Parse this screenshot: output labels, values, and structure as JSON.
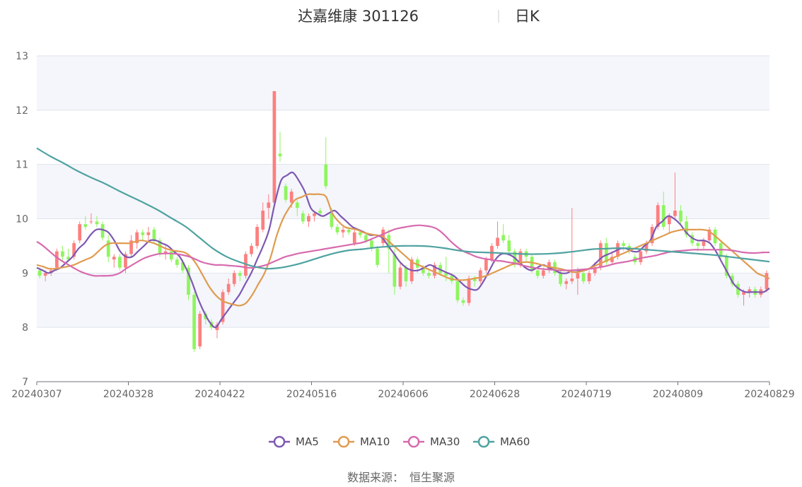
{
  "header": {
    "title": "达嘉维康 301126",
    "period": "日K"
  },
  "source": {
    "label": "数据来源：",
    "value": "恒生聚源"
  },
  "colors": {
    "up": "#fd7f7f",
    "down": "#8ef55e",
    "MA5": "#7e57b2",
    "MA10": "#e09b4f",
    "MA30": "#d76aae",
    "MA60": "#4fa2a0",
    "band": "#f4f6fb",
    "grid": "#dfe3ec"
  },
  "chart_data": {
    "type": "candlestick",
    "ylim": [
      7,
      13
    ],
    "yticks": [
      7,
      8,
      9,
      10,
      11,
      12,
      13
    ],
    "x_range": [
      "20240307",
      "20240829"
    ],
    "xticks": [
      "20240307",
      "20240328",
      "20240422",
      "20240516",
      "20240606",
      "20240628",
      "20240719",
      "20240809",
      "20240829"
    ],
    "legend": [
      "MA5",
      "MA10",
      "MA30",
      "MA60"
    ],
    "legend_position": "bottom-center",
    "candles_ohlc": [
      [
        9.05,
        9.1,
        8.9,
        8.95
      ],
      [
        8.95,
        9.05,
        8.85,
        9.0
      ],
      [
        9.0,
        9.1,
        8.95,
        9.05
      ],
      [
        9.1,
        9.45,
        9.05,
        9.4
      ],
      [
        9.4,
        9.5,
        9.2,
        9.3
      ],
      [
        9.3,
        9.45,
        9.2,
        9.25
      ],
      [
        9.3,
        9.6,
        9.25,
        9.55
      ],
      [
        9.6,
        9.95,
        9.55,
        9.9
      ],
      [
        9.9,
        10.05,
        9.8,
        9.85
      ],
      [
        9.95,
        10.1,
        9.9,
        9.95
      ],
      [
        9.95,
        10.05,
        9.85,
        9.9
      ],
      [
        9.9,
        9.95,
        9.6,
        9.65
      ],
      [
        9.6,
        9.7,
        9.2,
        9.3
      ],
      [
        9.25,
        9.35,
        9.1,
        9.3
      ],
      [
        9.3,
        9.35,
        9.05,
        9.1
      ],
      [
        9.1,
        9.4,
        9.0,
        9.35
      ],
      [
        9.35,
        9.7,
        9.3,
        9.6
      ],
      [
        9.55,
        9.8,
        9.45,
        9.75
      ],
      [
        9.75,
        9.8,
        9.6,
        9.7
      ],
      [
        9.7,
        9.85,
        9.6,
        9.75
      ],
      [
        9.8,
        9.85,
        9.55,
        9.6
      ],
      [
        9.6,
        9.65,
        9.3,
        9.35
      ],
      [
        9.35,
        9.5,
        9.25,
        9.4
      ],
      [
        9.4,
        9.45,
        9.2,
        9.25
      ],
      [
        9.25,
        9.3,
        9.1,
        9.15
      ],
      [
        9.2,
        9.25,
        9.0,
        9.05
      ],
      [
        9.1,
        9.15,
        8.5,
        8.6
      ],
      [
        8.6,
        8.65,
        7.55,
        7.6
      ],
      [
        7.65,
        8.3,
        7.6,
        8.25
      ],
      [
        8.25,
        8.3,
        8.05,
        8.15
      ],
      [
        8.1,
        8.15,
        7.95,
        8.0
      ],
      [
        7.95,
        8.1,
        7.8,
        8.05
      ],
      [
        8.1,
        8.7,
        8.05,
        8.65
      ],
      [
        8.65,
        8.9,
        8.6,
        8.8
      ],
      [
        8.8,
        9.05,
        8.75,
        9.0
      ],
      [
        9.0,
        9.05,
        8.85,
        8.95
      ],
      [
        8.95,
        9.4,
        8.9,
        9.35
      ],
      [
        9.35,
        9.55,
        9.3,
        9.5
      ],
      [
        9.5,
        9.9,
        9.45,
        9.85
      ],
      [
        9.8,
        10.3,
        9.75,
        10.15
      ],
      [
        10.2,
        10.45,
        10.0,
        10.3
      ],
      [
        10.3,
        12.35,
        10.25,
        12.35
      ],
      [
        11.2,
        11.6,
        11.05,
        11.15
      ],
      [
        10.6,
        10.65,
        10.3,
        10.35
      ],
      [
        10.3,
        10.55,
        10.2,
        10.5
      ],
      [
        10.3,
        10.35,
        10.05,
        10.2
      ],
      [
        10.1,
        10.15,
        9.9,
        9.95
      ],
      [
        9.95,
        10.1,
        9.85,
        10.05
      ],
      [
        10.05,
        10.15,
        9.95,
        10.1
      ],
      [
        10.15,
        10.2,
        10.05,
        10.1
      ],
      [
        11.0,
        11.5,
        10.55,
        10.6
      ],
      [
        10.1,
        10.2,
        9.8,
        9.85
      ],
      [
        9.85,
        9.9,
        9.7,
        9.75
      ],
      [
        9.75,
        9.85,
        9.65,
        9.8
      ],
      [
        9.8,
        9.85,
        9.7,
        9.75
      ],
      [
        9.55,
        9.8,
        9.5,
        9.75
      ],
      [
        9.75,
        9.8,
        9.65,
        9.7
      ],
      [
        9.7,
        9.75,
        9.55,
        9.6
      ],
      [
        9.6,
        9.65,
        9.4,
        9.45
      ],
      [
        9.45,
        9.5,
        9.1,
        9.15
      ],
      [
        9.55,
        9.85,
        9.5,
        9.8
      ],
      [
        9.7,
        9.8,
        9.0,
        9.45
      ],
      [
        9.35,
        9.45,
        8.6,
        8.75
      ],
      [
        8.75,
        9.2,
        8.7,
        9.1
      ],
      [
        9.1,
        9.15,
        8.75,
        8.85
      ],
      [
        8.85,
        9.3,
        8.8,
        9.25
      ],
      [
        9.25,
        9.3,
        9.0,
        9.1
      ],
      [
        9.1,
        9.15,
        8.95,
        9.0
      ],
      [
        9.0,
        9.05,
        8.9,
        8.95
      ],
      [
        8.95,
        9.2,
        8.9,
        9.15
      ],
      [
        9.15,
        9.2,
        8.95,
        9.0
      ],
      [
        9.0,
        9.3,
        8.85,
        8.95
      ],
      [
        8.95,
        9.0,
        8.8,
        8.85
      ],
      [
        8.85,
        8.9,
        8.45,
        8.5
      ],
      [
        8.5,
        8.55,
        8.4,
        8.45
      ],
      [
        8.45,
        8.95,
        8.4,
        8.9
      ],
      [
        8.9,
        8.95,
        8.75,
        8.85
      ],
      [
        8.85,
        9.1,
        8.8,
        9.05
      ],
      [
        9.05,
        9.3,
        9.0,
        9.25
      ],
      [
        9.25,
        9.55,
        9.2,
        9.5
      ],
      [
        9.5,
        9.95,
        9.45,
        9.65
      ],
      [
        9.7,
        9.9,
        9.55,
        9.6
      ],
      [
        9.6,
        9.7,
        9.35,
        9.4
      ],
      [
        9.4,
        9.45,
        9.1,
        9.15
      ],
      [
        9.15,
        9.45,
        9.1,
        9.4
      ],
      [
        9.4,
        9.45,
        9.2,
        9.3
      ],
      [
        9.3,
        9.35,
        9.0,
        9.05
      ],
      [
        9.05,
        9.1,
        8.9,
        8.95
      ],
      [
        8.95,
        9.1,
        8.9,
        9.05
      ],
      [
        9.05,
        9.25,
        9.0,
        9.2
      ],
      [
        9.2,
        9.25,
        8.95,
        9.0
      ],
      [
        9.0,
        9.05,
        8.75,
        8.8
      ],
      [
        8.8,
        8.9,
        8.7,
        8.85
      ],
      [
        8.85,
        10.2,
        8.8,
        8.9
      ],
      [
        8.9,
        9.1,
        8.6,
        9.0
      ],
      [
        9.0,
        9.05,
        8.8,
        8.85
      ],
      [
        8.85,
        9.05,
        8.8,
        9.0
      ],
      [
        9.0,
        9.2,
        8.95,
        9.1
      ],
      [
        9.1,
        9.6,
        9.05,
        9.55
      ],
      [
        9.55,
        9.65,
        9.15,
        9.2
      ],
      [
        9.2,
        9.4,
        9.15,
        9.3
      ],
      [
        9.3,
        9.6,
        9.25,
        9.55
      ],
      [
        9.55,
        9.6,
        9.4,
        9.5
      ],
      [
        9.5,
        9.55,
        9.35,
        9.4
      ],
      [
        9.3,
        9.35,
        9.15,
        9.2
      ],
      [
        9.2,
        9.45,
        9.15,
        9.4
      ],
      [
        9.4,
        9.6,
        9.35,
        9.55
      ],
      [
        9.55,
        9.9,
        9.5,
        9.85
      ],
      [
        9.85,
        10.3,
        9.8,
        10.25
      ],
      [
        10.25,
        10.5,
        9.8,
        9.85
      ],
      [
        9.9,
        10.1,
        9.75,
        10.05
      ],
      [
        10.05,
        10.85,
        10.0,
        10.15
      ],
      [
        10.15,
        10.25,
        9.9,
        9.95
      ],
      [
        9.95,
        10.05,
        9.65,
        9.7
      ],
      [
        9.7,
        9.75,
        9.5,
        9.55
      ],
      [
        9.55,
        9.6,
        9.4,
        9.5
      ],
      [
        9.5,
        9.65,
        9.45,
        9.6
      ],
      [
        9.6,
        9.85,
        9.55,
        9.8
      ],
      [
        9.8,
        9.85,
        9.5,
        9.55
      ],
      [
        9.55,
        9.6,
        9.25,
        9.3
      ],
      [
        9.3,
        9.35,
        8.9,
        8.95
      ],
      [
        8.95,
        9.0,
        8.75,
        8.8
      ],
      [
        8.8,
        8.85,
        8.55,
        8.6
      ],
      [
        8.6,
        8.7,
        8.4,
        8.65
      ],
      [
        8.65,
        8.75,
        8.55,
        8.7
      ],
      [
        8.7,
        8.75,
        8.55,
        8.6
      ],
      [
        8.6,
        8.75,
        8.55,
        8.7
      ],
      [
        8.7,
        9.05,
        8.65,
        9.0
      ]
    ],
    "series": [
      {
        "name": "MA5",
        "values": [
          9.1,
          9.05,
          9.0,
          9.05,
          9.1,
          9.2,
          9.3,
          9.45,
          9.55,
          9.7,
          9.8,
          9.8,
          9.75,
          9.6,
          9.4,
          9.3,
          9.3,
          9.4,
          9.5,
          9.6,
          9.6,
          9.55,
          9.5,
          9.4,
          9.3,
          9.1,
          8.85,
          8.55,
          8.3,
          8.1,
          8.0,
          8.15,
          8.3,
          8.45,
          8.6,
          8.8,
          9.0,
          9.25,
          9.5,
          9.8,
          10.3,
          10.7,
          10.8,
          10.85,
          10.7,
          10.5,
          10.2,
          10.1,
          10.05,
          10.1,
          10.15,
          10.05,
          9.95,
          9.85,
          9.8,
          9.75,
          9.7,
          9.7,
          9.65,
          9.5,
          9.35,
          9.2,
          9.1,
          9.05,
          9.05,
          9.1,
          9.15,
          9.1,
          9.05,
          9.0,
          8.95,
          8.85,
          8.75,
          8.7,
          8.7,
          8.85,
          9.05,
          9.25,
          9.35,
          9.35,
          9.3,
          9.2,
          9.1,
          9.05,
          9.1,
          9.15,
          9.1,
          9.05,
          9.0,
          9.0,
          9.05,
          9.05,
          9.05,
          9.1,
          9.2,
          9.3,
          9.35,
          9.4,
          9.45,
          9.45,
          9.4,
          9.4,
          9.5,
          9.6,
          9.85,
          9.95,
          10.05,
          10.0,
          9.9,
          9.75,
          9.65,
          9.6,
          9.6,
          9.55,
          9.4,
          9.2,
          9.0,
          8.8,
          8.7,
          8.65,
          8.65,
          8.65,
          8.65,
          8.72
        ]
      },
      {
        "name": "MA10",
        "values": [
          9.15,
          9.12,
          9.08,
          9.08,
          9.1,
          9.12,
          9.15,
          9.2,
          9.25,
          9.3,
          9.4,
          9.5,
          9.55,
          9.55,
          9.55,
          9.55,
          9.58,
          9.6,
          9.58,
          9.55,
          9.5,
          9.45,
          9.42,
          9.4,
          9.38,
          9.3,
          9.15,
          8.95,
          8.75,
          8.6,
          8.5,
          8.45,
          8.42,
          8.4,
          8.45,
          8.6,
          8.8,
          9.0,
          9.3,
          9.7,
          10.0,
          10.2,
          10.35,
          10.4,
          10.45,
          10.45,
          10.45,
          10.4,
          10.1,
          9.95,
          9.85,
          9.82,
          9.8,
          9.75,
          9.72,
          9.7,
          9.68,
          9.6,
          9.5,
          9.4,
          9.3,
          9.2,
          9.15,
          9.1,
          9.05,
          9.0,
          8.95,
          8.9,
          8.88,
          8.87,
          8.88,
          8.9,
          8.92,
          8.95,
          9.0,
          9.05,
          9.1,
          9.15,
          9.18,
          9.2,
          9.2,
          9.18,
          9.15,
          9.12,
          9.1,
          9.08,
          9.05,
          9.02,
          9.02,
          9.05,
          9.1,
          9.15,
          9.2,
          9.25,
          9.3,
          9.35,
          9.4,
          9.45,
          9.5,
          9.55,
          9.6,
          9.65,
          9.7,
          9.75,
          9.78,
          9.8,
          9.8,
          9.8,
          9.8,
          9.78,
          9.7,
          9.6,
          9.5,
          9.4,
          9.3,
          9.2,
          9.1,
          9.0,
          8.95,
          8.9
        ]
      },
      {
        "name": "MA30",
        "values": [
          9.58,
          9.5,
          9.4,
          9.3,
          9.22,
          9.15,
          9.08,
          9.02,
          8.98,
          8.95,
          8.95,
          8.95,
          8.96,
          9.0,
          9.08,
          9.15,
          9.22,
          9.28,
          9.32,
          9.35,
          9.36,
          9.36,
          9.35,
          9.33,
          9.3,
          9.25,
          9.2,
          9.17,
          9.15,
          9.15,
          9.14,
          9.13,
          9.12,
          9.1,
          9.1,
          9.12,
          9.15,
          9.2,
          9.25,
          9.3,
          9.33,
          9.36,
          9.38,
          9.4,
          9.42,
          9.44,
          9.46,
          9.48,
          9.5,
          9.52,
          9.54,
          9.56,
          9.6,
          9.65,
          9.7,
          9.75,
          9.8,
          9.83,
          9.85,
          9.87,
          9.88,
          9.87,
          9.85,
          9.8,
          9.7,
          9.58,
          9.48,
          9.4,
          9.35,
          9.3,
          9.27,
          9.25,
          9.23,
          9.22,
          9.2,
          9.18,
          9.15,
          9.12,
          9.1,
          9.08,
          9.07,
          9.06,
          9.05,
          9.05,
          9.05,
          9.06,
          9.07,
          9.08,
          9.1,
          9.12,
          9.15,
          9.18,
          9.2,
          9.22,
          9.25,
          9.28,
          9.3,
          9.32,
          9.35,
          9.38,
          9.4,
          9.41,
          9.42,
          9.43,
          9.43,
          9.43,
          9.43,
          9.43,
          9.43,
          9.42,
          9.4,
          9.38,
          9.37,
          9.37,
          9.38,
          9.38
        ]
      },
      {
        "name": "MA60",
        "values": [
          11.3,
          11.15,
          11.02,
          10.88,
          10.76,
          10.65,
          10.52,
          10.4,
          10.28,
          10.15,
          10.0,
          9.85,
          9.65,
          9.45,
          9.3,
          9.2,
          9.12,
          9.08,
          9.1,
          9.15,
          9.22,
          9.3,
          9.37,
          9.42,
          9.44,
          9.47,
          9.49,
          9.5,
          9.5,
          9.49,
          9.46,
          9.42,
          9.39,
          9.38,
          9.37,
          9.36,
          9.35,
          9.35,
          9.36,
          9.38,
          9.41,
          9.44,
          9.45,
          9.46,
          9.45,
          9.43,
          9.41,
          9.39,
          9.37,
          9.35,
          9.33,
          9.3,
          9.27,
          9.24,
          9.21
        ]
      }
    ]
  }
}
